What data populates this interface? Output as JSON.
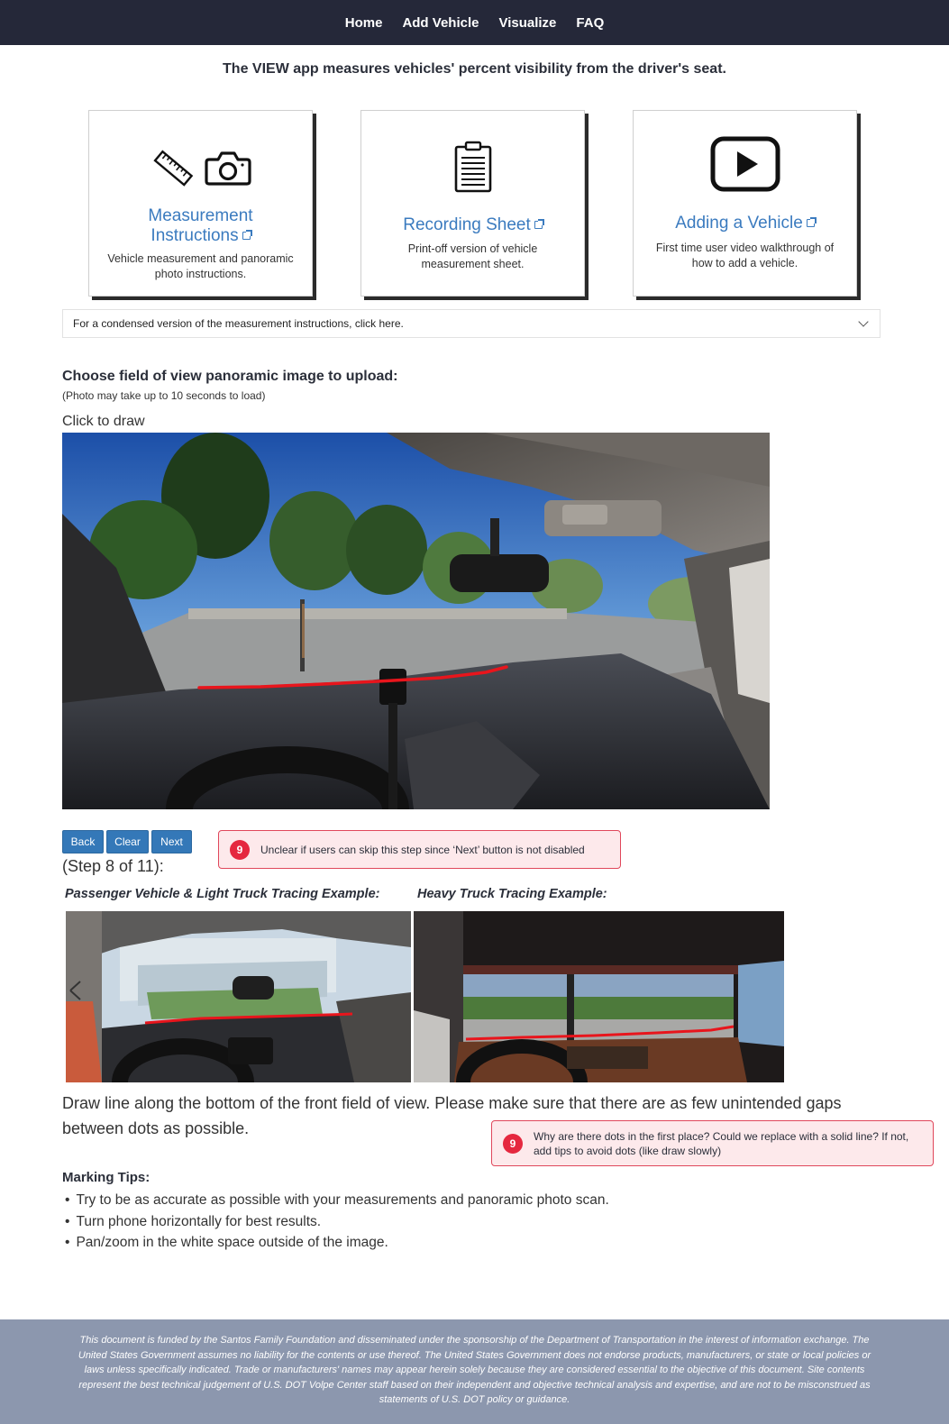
{
  "nav": {
    "items": [
      "Home",
      "Add Vehicle",
      "Visualize",
      "FAQ"
    ]
  },
  "tagline": "The VIEW app measures vehicles' percent visibility from the driver's seat.",
  "cards": [
    {
      "title_line1": "Measurement",
      "title_line2": "Instructions",
      "desc": "Vehicle measurement and panoramic photo instructions.",
      "icons": [
        "ruler-icon",
        "camera-icon"
      ]
    },
    {
      "title": "Recording Sheet",
      "desc": "Print-off version of vehicle measurement sheet.",
      "icons": [
        "clipboard-icon"
      ]
    },
    {
      "title": "Adding a Vehicle",
      "desc": "First time user video walkthrough of how to add a vehicle.",
      "icons": [
        "play-video-icon"
      ]
    }
  ],
  "accordion": {
    "label": "For a condensed version of the measurement instructions, click here."
  },
  "upload": {
    "title": "Choose field of view panoramic image to upload:",
    "note": "(Photo may take up to 10 seconds to load)",
    "click_to_draw": "Click to draw"
  },
  "buttons": {
    "back": "Back",
    "clear": "Clear",
    "next": "Next"
  },
  "annotations": [
    {
      "badge": "9",
      "text": "Unclear if users can skip this step since ‘Next’ button is not disabled"
    },
    {
      "badge": "9",
      "text": "Why are there dots in the first place? Could we replace with a solid line? If not, add tips to avoid dots (like draw slowly)"
    }
  ],
  "step": "(Step 8 of 11):",
  "examples": {
    "passenger_title": "Passenger Vehicle & Light Truck Tracing Example:",
    "heavy_title": "Heavy Truck Tracing Example:"
  },
  "instructions": "Draw line along the bottom of the front field of view. Please make sure that there are as few unintended gaps between dots as possible.",
  "tips": {
    "title": "Marking Tips:",
    "items": [
      "Try to be as accurate as possible with your measurements and panoramic photo scan.",
      "Turn phone horizontally for best results.",
      "Pan/zoom in the white space outside of the image."
    ]
  },
  "footer": "This document is funded by the Santos Family Foundation and disseminated under the sponsorship of the Department of Transportation in the interest of information exchange. The United States Government assumes no liability for the contents or use thereof. The United States Government does not endorse products, manufacturers, or state or local policies or laws unless specifically indicated. Trade or manufacturers' names may appear herein solely because they are considered essential to the objective of this document. Site contents represent the best technical judgement of U.S. DOT Volpe Center staff based on their independent and objective technical analysis and expertise, and are not to be misconstrued as statements of U.S. DOT policy or guidance.",
  "colors": {
    "nav_bg": "#252839",
    "link_blue": "#3b7bbf",
    "button_blue": "#3478b8",
    "trace_red": "#e8151c",
    "footer_bg": "#8c97ae",
    "note_bg": "#fde9eb",
    "note_border": "#e0475b"
  }
}
